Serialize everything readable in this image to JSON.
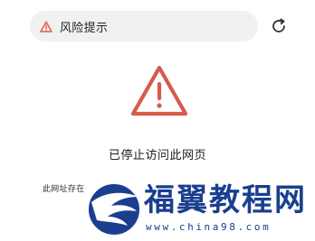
{
  "address_bar": {
    "icon": "warning-triangle-icon",
    "text": "风险提示",
    "icon_color": "#d85a4a"
  },
  "toolbar": {
    "refresh_icon": "refresh-icon"
  },
  "main": {
    "warning_icon": "warning-triangle-icon",
    "warning_color": "#d85a4a",
    "title": "已停止访问此网页",
    "detail": "此网址存在"
  },
  "watermark": {
    "logo": "eagle-logo",
    "text": "福翼教程网",
    "url": "www.china98.com",
    "color": "#1a3f8f"
  }
}
